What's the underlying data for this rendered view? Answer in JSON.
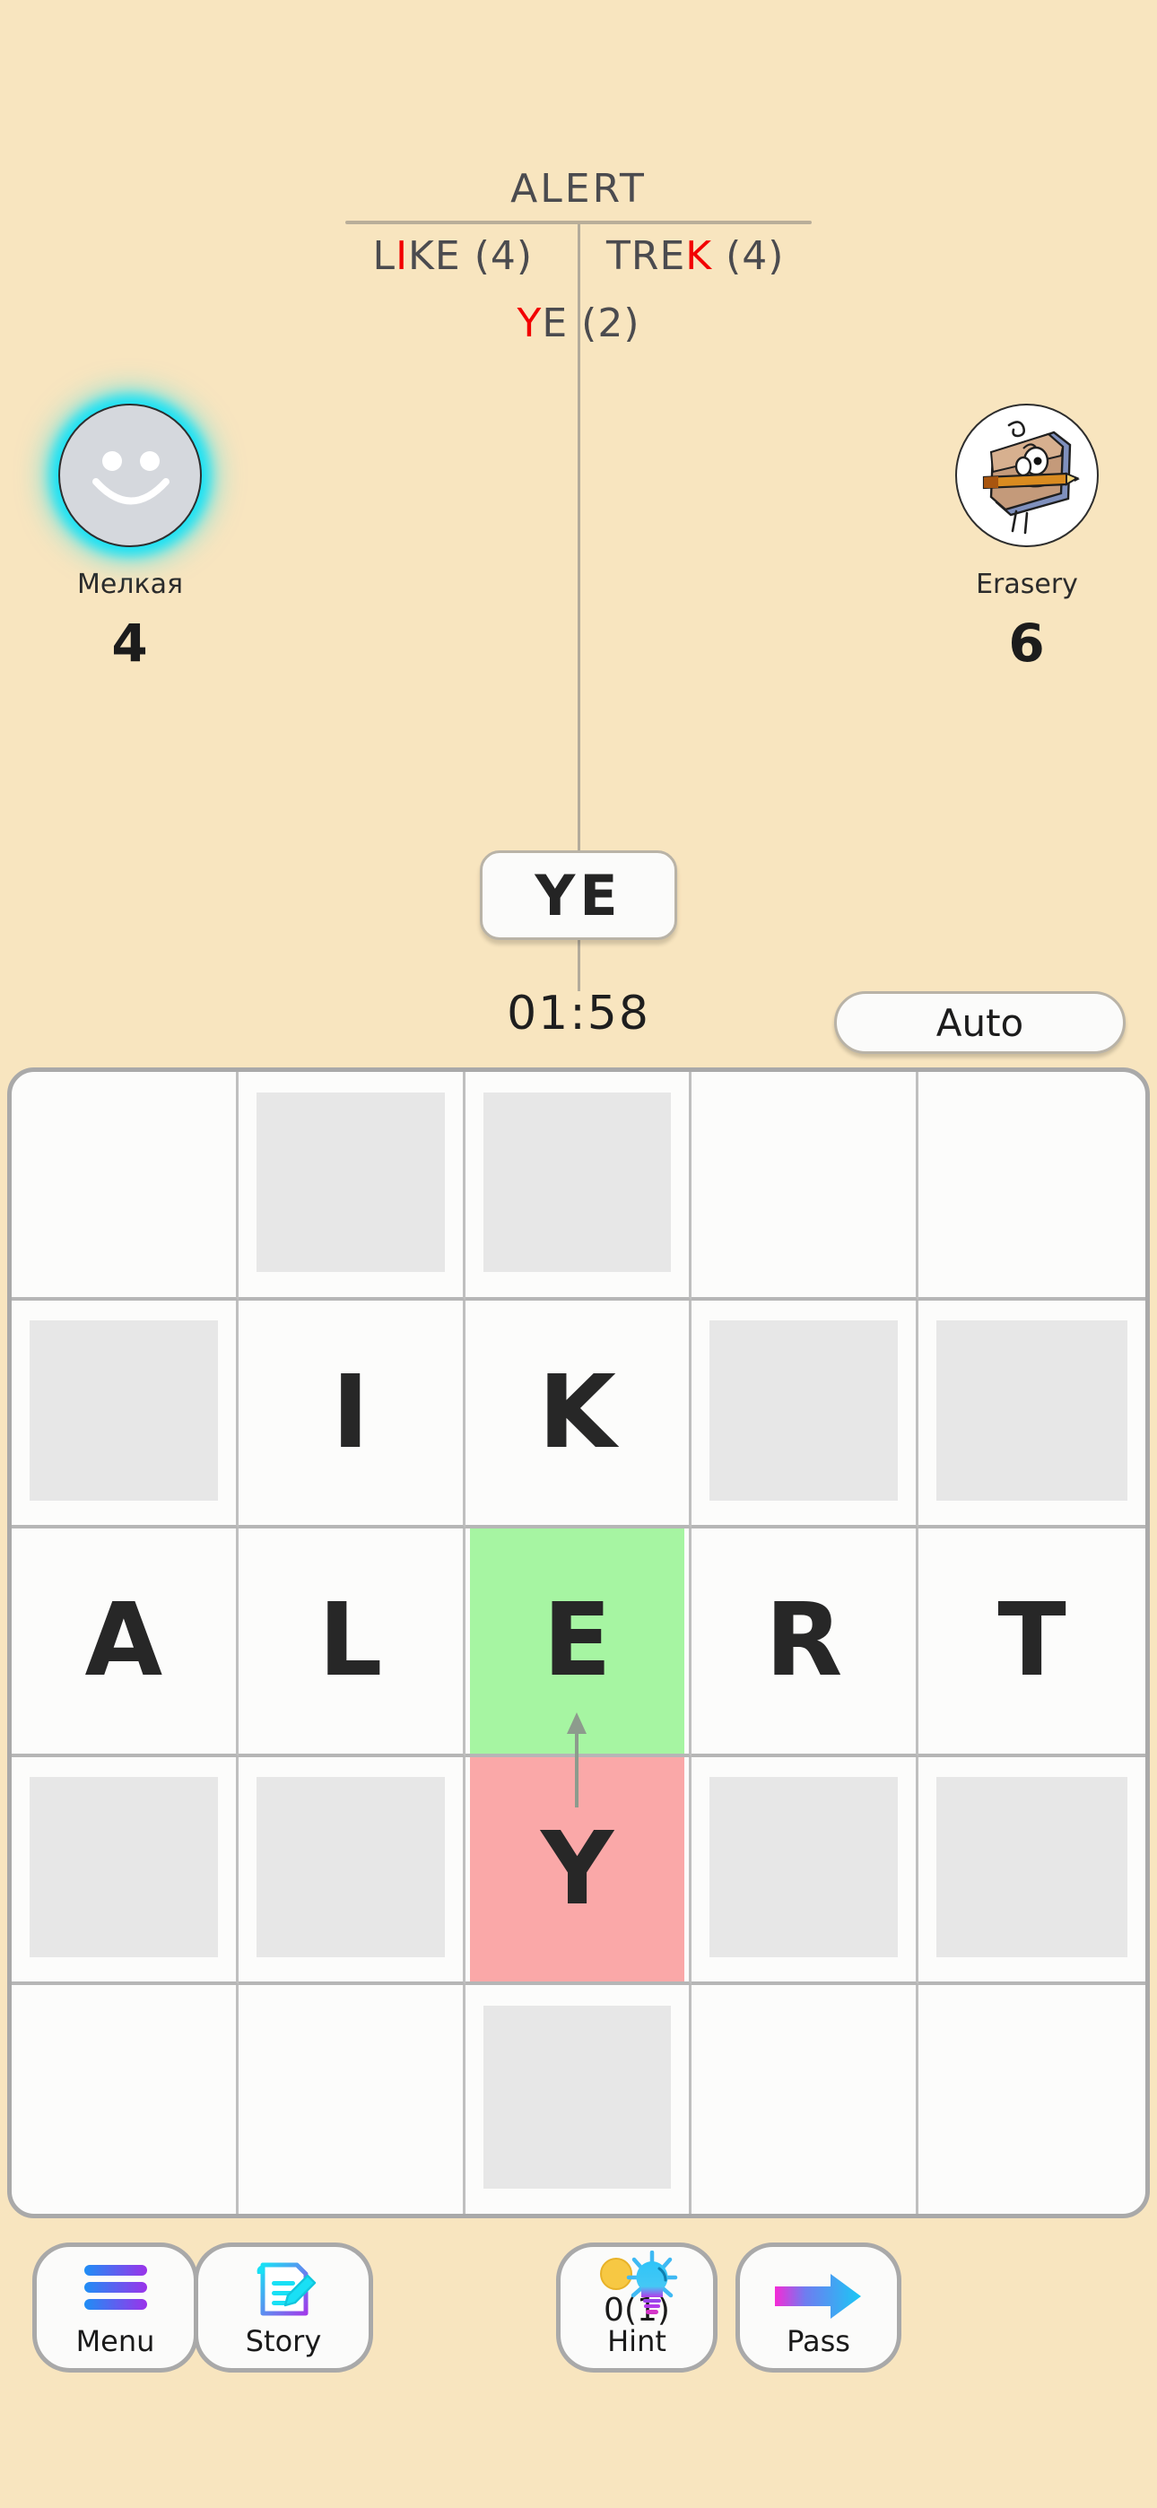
{
  "header": {
    "played_word": "ALERT",
    "formed_words": [
      [
        {
          "text": "L",
          "highlight": false
        },
        {
          "text": "I",
          "highlight": true
        },
        {
          "text": "KE (4)",
          "highlight": false
        }
      ],
      [
        {
          "text": "TRE",
          "highlight": false
        },
        {
          "text": "K",
          "highlight": true
        },
        {
          "text": " (4)",
          "highlight": false
        }
      ],
      [
        {
          "text": "Y",
          "highlight": true
        },
        {
          "text": "E (2)",
          "highlight": false
        }
      ]
    ],
    "highlight_color": "#f20000"
  },
  "players": [
    {
      "name": "Мелкая",
      "score": "4",
      "avatar": "smiley-face-avatar",
      "active": true,
      "glow_color": "#19e2f5"
    },
    {
      "name": "Erasery",
      "score": "6",
      "avatar": "eraser-character-avatar",
      "active": false,
      "glow_color": ""
    }
  ],
  "current_tile": {
    "letters": "YE"
  },
  "timer": {
    "value": "01:58"
  },
  "auto_button": {
    "label": "Auto"
  },
  "board": {
    "rows": 5,
    "cols": 5,
    "cells": [
      [
        {
          "letter": "",
          "state": "empty"
        },
        {
          "letter": "",
          "state": "blocked"
        },
        {
          "letter": "",
          "state": "blocked"
        },
        {
          "letter": "",
          "state": "empty"
        },
        {
          "letter": "",
          "state": "empty"
        }
      ],
      [
        {
          "letter": "",
          "state": "blocked"
        },
        {
          "letter": "I",
          "state": "filled"
        },
        {
          "letter": "K",
          "state": "filled"
        },
        {
          "letter": "",
          "state": "blocked"
        },
        {
          "letter": "",
          "state": "blocked"
        }
      ],
      [
        {
          "letter": "A",
          "state": "filled"
        },
        {
          "letter": "L",
          "state": "filled"
        },
        {
          "letter": "E",
          "state": "green"
        },
        {
          "letter": "R",
          "state": "filled"
        },
        {
          "letter": "T",
          "state": "filled"
        }
      ],
      [
        {
          "letter": "",
          "state": "blocked"
        },
        {
          "letter": "",
          "state": "blocked"
        },
        {
          "letter": "Y",
          "state": "red"
        },
        {
          "letter": "",
          "state": "blocked"
        },
        {
          "letter": "",
          "state": "blocked"
        }
      ],
      [
        {
          "letter": "",
          "state": "empty"
        },
        {
          "letter": "",
          "state": "empty"
        },
        {
          "letter": "",
          "state": "blocked"
        },
        {
          "letter": "",
          "state": "empty"
        },
        {
          "letter": "",
          "state": "empty"
        }
      ]
    ],
    "green_color": "#a6f5a2",
    "red_color": "#faa8a8",
    "blocked_color": "#e7e7e7"
  },
  "bottom_nav": [
    {
      "id": "menu",
      "label": "Menu",
      "count": "",
      "icon": "hamburger-menu-icon"
    },
    {
      "id": "story",
      "label": "Story",
      "count": "",
      "icon": "document-pencil-icon"
    },
    {
      "id": "hint",
      "label": "Hint",
      "count": "0(1)",
      "icon": "lightbulb-coin-icon"
    },
    {
      "id": "pass",
      "label": "Pass",
      "count": "",
      "icon": "right-arrow-icon"
    }
  ]
}
